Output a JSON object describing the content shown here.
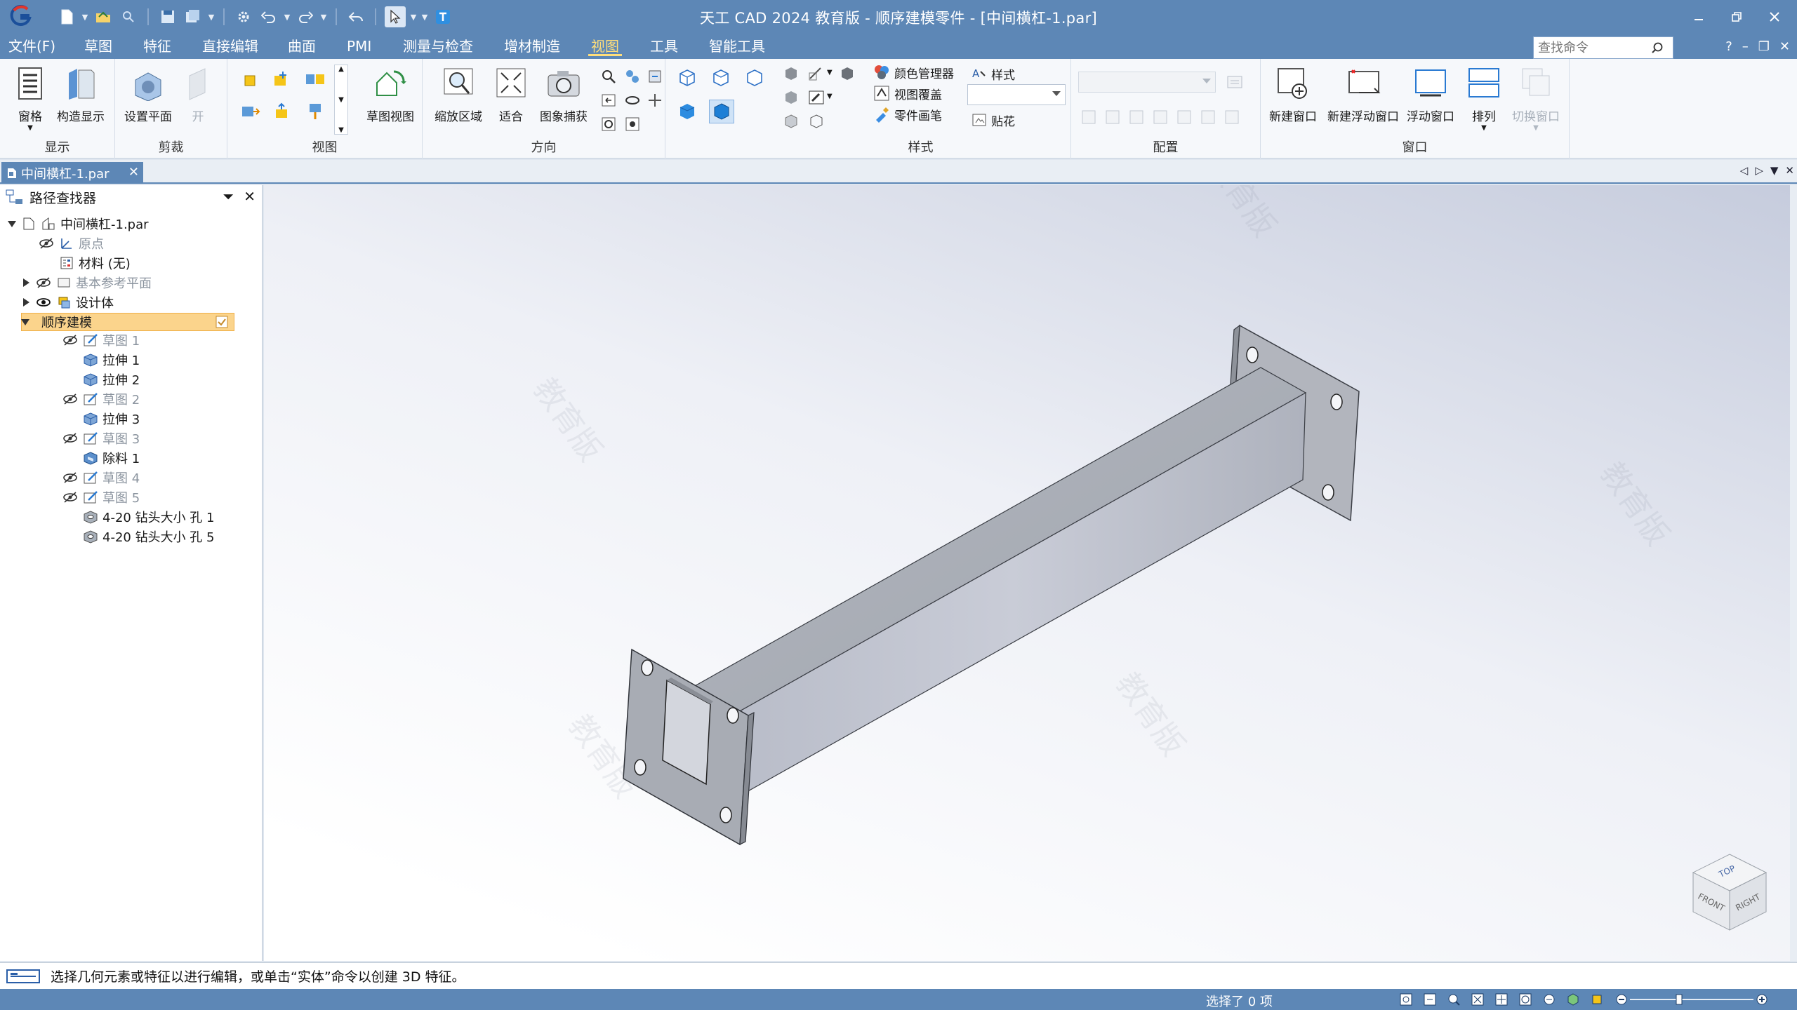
{
  "window": {
    "title": "天工 CAD 2024 教育版 - 顺序建模零件 - [中间横杠-1.par]"
  },
  "menu": {
    "file": "文件(F)",
    "tabs": [
      "草图",
      "特征",
      "直接编辑",
      "曲面",
      "PMI",
      "测量与检查",
      "增材制造",
      "视图",
      "工具",
      "智能工具"
    ],
    "active_tab": "视图",
    "search_placeholder": "查找命令",
    "help": "?"
  },
  "ribbon": {
    "display": {
      "label": "显示",
      "pane": "窗格",
      "structure": "构造显示"
    },
    "clip": {
      "label": "剪裁",
      "set_plane": "设置平面",
      "open": "开"
    },
    "view": {
      "label": "视图",
      "sketch_view": "草图视图"
    },
    "orient": {
      "label": "方向",
      "zoom_area": "缩放区域",
      "fit": "适合",
      "capture": "图象捕获"
    },
    "style": {
      "label": "样式",
      "color_manager": "颜色管理器",
      "view_overlay": "视图覆盖",
      "part_painter": "零件画笔",
      "style": "样式",
      "decal": "贴花"
    },
    "config": {
      "label": "配置"
    },
    "window": {
      "label": "窗口",
      "new_window": "新建窗口",
      "new_float": "新建浮动窗口",
      "float": "浮动窗口",
      "arrange": "排列",
      "switch": "切换窗口"
    }
  },
  "doc_tab": {
    "name": "中间横杠-1.par"
  },
  "pathfinder": {
    "title": "路径查找器",
    "root": "中间横杠-1.par",
    "items": [
      {
        "label": "原点",
        "dim": true
      },
      {
        "label": "材料 (无)",
        "dim": false
      },
      {
        "label": "基本参考平面",
        "dim": true
      },
      {
        "label": "设计体",
        "dim": false
      },
      {
        "label": "顺序建模",
        "dim": false
      }
    ],
    "features": [
      {
        "label": "草图 1",
        "kind": "sketch"
      },
      {
        "label": "拉伸 1",
        "kind": "extrude"
      },
      {
        "label": "拉伸 2",
        "kind": "extrude"
      },
      {
        "label": "草图 2",
        "kind": "sketch"
      },
      {
        "label": "拉伸 3",
        "kind": "extrude"
      },
      {
        "label": "草图 3",
        "kind": "sketch"
      },
      {
        "label": "除料 1",
        "kind": "cut"
      },
      {
        "label": "草图 4",
        "kind": "sketch"
      },
      {
        "label": "草图 5",
        "kind": "sketch"
      },
      {
        "label": "4-20 钻头大小 孔 1",
        "kind": "hole"
      },
      {
        "label": "4-20 钻头大小 孔 5",
        "kind": "hole"
      }
    ]
  },
  "viewport": {
    "watermark": "教育版",
    "viewcube": {
      "top": "TOP",
      "front": "FRONT",
      "right": "RIGHT"
    }
  },
  "prompt": {
    "text": "选择几何元素或特征以进行编辑，或单击“实体”命令以创建 3D 特征。"
  },
  "status": {
    "selection": "选择了 0 项"
  },
  "colors": {
    "accent": "#5d87b6",
    "highlight": "#fbd48c",
    "active_tab": "#ffde7a"
  }
}
